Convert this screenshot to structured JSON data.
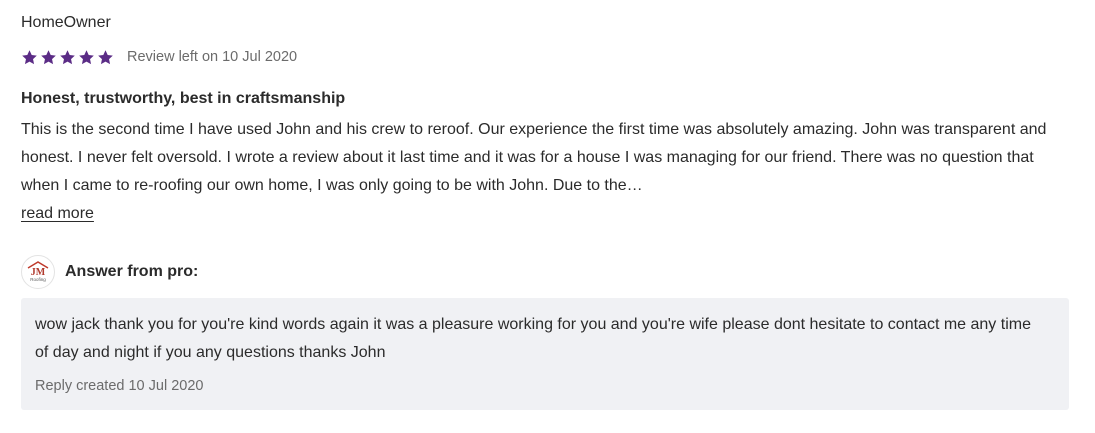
{
  "review": {
    "reviewer_name": "HomeOwner",
    "rating": 5,
    "rating_max": 5,
    "star_color": "#5b2c86",
    "date_text": "Review left on 10 Jul 2020",
    "title": "Honest, trustworthy, best in craftsmanship",
    "body": "This is the second time I have used John and his crew to reroof. Our experience the first time was absolutely amazing. John was transparent and honest. I never felt oversold. I wrote a review about it last time and it was for a house I was managing for our friend. There was no question that when I came to re-roofing our own home, I was only going to be with John. Due to the…",
    "read_more_label": "read more"
  },
  "answer": {
    "logo_text": "JM",
    "logo_subtext": "Roofing",
    "label": "Answer from pro:",
    "text": "wow jack thank you for you're kind words again it was a pleasure working for you and you're wife please dont hesitate to contact me any time of day and night if you any questions thanks John",
    "reply_date_text": "Reply created 10 Jul 2020",
    "box_color": "#f0f1f4"
  }
}
